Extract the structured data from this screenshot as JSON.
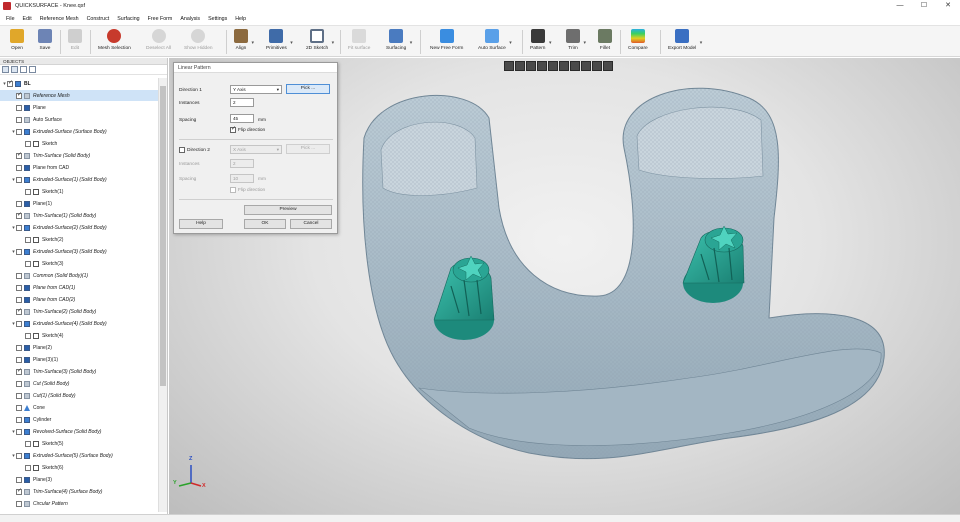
{
  "window": {
    "title": "QUICKSURFACE - Knee.qsf",
    "minimize": "—",
    "maximize": "☐",
    "close": "✕"
  },
  "menu": [
    "File",
    "Edit",
    "Reference Mesh",
    "Construct",
    "Surfacing",
    "Free Form",
    "Analysis",
    "Settings",
    "Help"
  ],
  "toolbar": [
    {
      "label": "Open",
      "icon": "folder-icon",
      "color": "#e0a72a",
      "enabled": true
    },
    {
      "label": "Save",
      "icon": "save-icon",
      "color": "#6d84b5",
      "enabled": true
    },
    {
      "label": "Edit",
      "icon": "edit-icon",
      "color": "#c9c9c9",
      "enabled": false
    },
    {
      "label": "Mesh Selection",
      "icon": "mesh-selection-icon",
      "color": "#c73a2c",
      "enabled": true
    },
    {
      "label": "Deselect All",
      "icon": "deselect-icon",
      "color": "#cfcfcf",
      "enabled": false
    },
    {
      "label": "Show Hidden",
      "icon": "eye-icon",
      "color": "#cfcfcf",
      "enabled": false
    },
    {
      "label": "Align",
      "icon": "align-icon",
      "color": "#8c6a3f",
      "enabled": true
    },
    {
      "label": "Primitives",
      "icon": "primitives-icon",
      "color": "#3f6ba8",
      "enabled": true
    },
    {
      "label": "2D Sketch",
      "icon": "sketch-icon",
      "color": "#5e6f86",
      "enabled": true
    },
    {
      "label": "Fit surface",
      "icon": "fit-surface-icon",
      "color": "#d2d2d2",
      "enabled": false
    },
    {
      "label": "Surfacing",
      "icon": "surfacing-icon",
      "color": "#4a7bc0",
      "enabled": true
    },
    {
      "label": "New Free Form",
      "icon": "free-form-icon",
      "color": "#3a8de0",
      "enabled": true
    },
    {
      "label": "Auto Surface",
      "icon": "auto-surface-icon",
      "color": "#5aa0e8",
      "enabled": true
    },
    {
      "label": "Pattern",
      "icon": "pattern-icon",
      "color": "#3a3a3a",
      "enabled": true
    },
    {
      "label": "Trim",
      "icon": "trim-icon",
      "color": "#6e6e6e",
      "enabled": true
    },
    {
      "label": "Fillet",
      "icon": "fillet-icon",
      "color": "#6b7a62",
      "enabled": true
    },
    {
      "label": "Compare",
      "icon": "compare-icon",
      "color": "#e05a2a",
      "enabled": true
    },
    {
      "label": "Export Model",
      "icon": "export-icon",
      "color": "#3a6fc2",
      "enabled": true
    }
  ],
  "objects_panel": {
    "title": "OBJECTS",
    "tree": [
      {
        "label": "BL",
        "level": 0,
        "expand": "▾",
        "checked": true,
        "icon": "root",
        "style": "bold"
      },
      {
        "label": "Reference Mesh",
        "level": 1,
        "checked": true,
        "icon": "grey",
        "style": "it",
        "selected": true
      },
      {
        "label": "Plane",
        "level": 1,
        "checked": false,
        "icon": "dark",
        "style": ""
      },
      {
        "label": "Auto Surface",
        "level": 1,
        "checked": false,
        "icon": "grey",
        "style": ""
      },
      {
        "label": "Extruded-Surface (Surface Body)",
        "level": 1,
        "expand": "▾",
        "checked": false,
        "icon": "normal",
        "style": "it"
      },
      {
        "label": "Sketch",
        "level": 2,
        "checked": false,
        "icon": "sketch",
        "style": ""
      },
      {
        "label": "Trim-Surface (Solid Body)",
        "level": 1,
        "checked": true,
        "icon": "grey",
        "style": "it"
      },
      {
        "label": "Plane from CAD",
        "level": 1,
        "checked": false,
        "icon": "dark",
        "style": ""
      },
      {
        "label": "Extruded-Surface(1) (Solid Body)",
        "level": 1,
        "expand": "▾",
        "checked": false,
        "icon": "normal",
        "style": "it"
      },
      {
        "label": "Sketch(1)",
        "level": 2,
        "checked": false,
        "icon": "sketch",
        "style": ""
      },
      {
        "label": "Plane(1)",
        "level": 1,
        "checked": false,
        "icon": "dark",
        "style": ""
      },
      {
        "label": "Trim-Surface(1) (Solid Body)",
        "level": 1,
        "checked": true,
        "icon": "grey",
        "style": "it"
      },
      {
        "label": "Extruded-Surface(2) (Solid Body)",
        "level": 1,
        "expand": "▾",
        "checked": false,
        "icon": "normal",
        "style": "it"
      },
      {
        "label": "Sketch(2)",
        "level": 2,
        "checked": false,
        "icon": "sketch",
        "style": ""
      },
      {
        "label": "Extruded-Surface(3) (Solid Body)",
        "level": 1,
        "expand": "▾",
        "checked": false,
        "icon": "normal",
        "style": "it"
      },
      {
        "label": "Sketch(3)",
        "level": 2,
        "checked": false,
        "icon": "sketch",
        "style": ""
      },
      {
        "label": "Common (Solid Body)(1)",
        "level": 1,
        "checked": false,
        "icon": "grey",
        "style": "it"
      },
      {
        "label": "Plane from CAD(1)",
        "level": 1,
        "checked": false,
        "icon": "dark",
        "style": "it"
      },
      {
        "label": "Plane from CAD(2)",
        "level": 1,
        "checked": false,
        "icon": "dark",
        "style": "it"
      },
      {
        "label": "Trim-Surface(2) (Solid Body)",
        "level": 1,
        "checked": true,
        "icon": "grey",
        "style": "it"
      },
      {
        "label": "Extruded-Surface(4) (Solid Body)",
        "level": 1,
        "expand": "▾",
        "checked": false,
        "icon": "normal",
        "style": "it"
      },
      {
        "label": "Sketch(4)",
        "level": 2,
        "checked": false,
        "icon": "sketch",
        "style": ""
      },
      {
        "label": "Plane(2)",
        "level": 1,
        "checked": false,
        "icon": "dark",
        "style": ""
      },
      {
        "label": "Plane(3)(1)",
        "level": 1,
        "checked": false,
        "icon": "dark",
        "style": ""
      },
      {
        "label": "Trim-Surface(3) (Solid Body)",
        "level": 1,
        "checked": true,
        "icon": "grey",
        "style": "it"
      },
      {
        "label": "Cut (Solid Body)",
        "level": 1,
        "checked": false,
        "icon": "grey",
        "style": "it"
      },
      {
        "label": "Cut(1) (Solid Body)",
        "level": 1,
        "checked": false,
        "icon": "grey",
        "style": "it"
      },
      {
        "label": "Cone",
        "level": 1,
        "checked": false,
        "icon": "tri",
        "style": ""
      },
      {
        "label": "Cylinder",
        "level": 1,
        "checked": false,
        "icon": "normal",
        "style": ""
      },
      {
        "label": "Revolved-Surface (Solid Body)",
        "level": 1,
        "expand": "▾",
        "checked": false,
        "icon": "normal",
        "style": "it"
      },
      {
        "label": "Sketch(5)",
        "level": 2,
        "checked": false,
        "icon": "sketch",
        "style": ""
      },
      {
        "label": "Extruded-Surface(5) (Surface Body)",
        "level": 1,
        "expand": "▾",
        "checked": false,
        "icon": "normal",
        "style": "it"
      },
      {
        "label": "Sketch(6)",
        "level": 2,
        "checked": false,
        "icon": "sketch",
        "style": ""
      },
      {
        "label": "Plane(3)",
        "level": 1,
        "checked": false,
        "icon": "dark",
        "style": ""
      },
      {
        "label": "Trim-Surface(4) (Surface Body)",
        "level": 1,
        "checked": true,
        "icon": "grey",
        "style": "it"
      },
      {
        "label": "Circular Pattern",
        "level": 1,
        "checked": false,
        "icon": "grey",
        "style": "it"
      }
    ]
  },
  "dialog": {
    "title": "Linear Pattern",
    "direction1_label": "Direction 1",
    "direction1_value": "Y Axis",
    "pick_label": "Pick ...",
    "instances_label": "Instances",
    "instances_value": "2",
    "spacing_label": "Spacing",
    "spacing_value": "45",
    "spacing_unit": "mm",
    "flip_direction_label": "Flip direction",
    "flip_direction_checked": true,
    "direction2_label": "Direction 2",
    "direction2_value": "X Axis",
    "pick2_label": "Pick ...",
    "instances2_label": "Instances",
    "instances2_value": "2",
    "spacing2_label": "Spacing",
    "spacing2_value": "10",
    "spacing2_unit": "mm",
    "flip2_label": "Flip direction",
    "preview_label": "Preview",
    "help_label": "Help",
    "ok_label": "OK",
    "cancel_label": "Cancel"
  },
  "axes": {
    "z": "Z",
    "y": "Y",
    "x": "X"
  },
  "colors": {
    "accent": "#3d7fd1",
    "model_surface": "#a9bcc8",
    "boss_teal": "#2aa594",
    "viewport_bg": "#d9d9d9"
  }
}
